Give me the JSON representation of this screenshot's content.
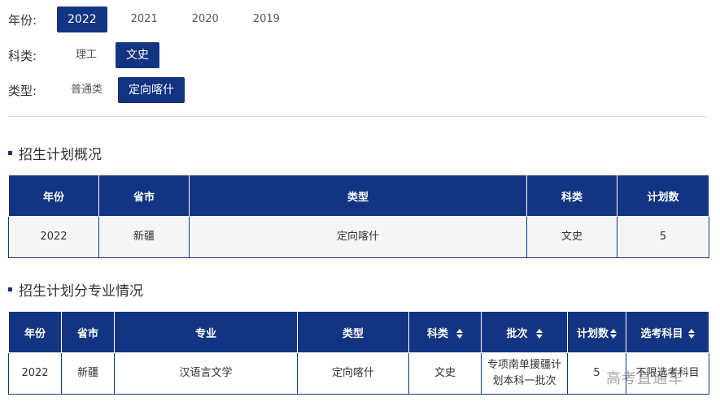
{
  "filters": {
    "year": {
      "label": "年份:",
      "options": [
        "2022",
        "2021",
        "2020",
        "2019"
      ],
      "selected": "2022"
    },
    "subject": {
      "label": "科类:",
      "options": [
        "理工",
        "文史"
      ],
      "selected": "文史"
    },
    "type": {
      "label": "类型:",
      "options": [
        "普通类",
        "定向喀什"
      ],
      "selected": "定向喀什"
    }
  },
  "overview": {
    "title": "招生计划概况",
    "headers": [
      "年份",
      "省市",
      "类型",
      "科类",
      "计划数"
    ],
    "rows": [
      [
        "2022",
        "新疆",
        "定向喀什",
        "文史",
        "5"
      ]
    ]
  },
  "major": {
    "title": "招生计划分专业情况",
    "headers": [
      "年份",
      "省市",
      "专业",
      "类型",
      "科类",
      "批次",
      "计划数",
      "选考科目"
    ],
    "rows": [
      [
        "2022",
        "新疆",
        "汉语言文学",
        "定向喀什",
        "文史",
        "专项南单援疆计划本科一批次",
        "5",
        "不限选考科目"
      ]
    ]
  },
  "watermark": "高考直通车",
  "colors": {
    "primary": "#123483"
  }
}
